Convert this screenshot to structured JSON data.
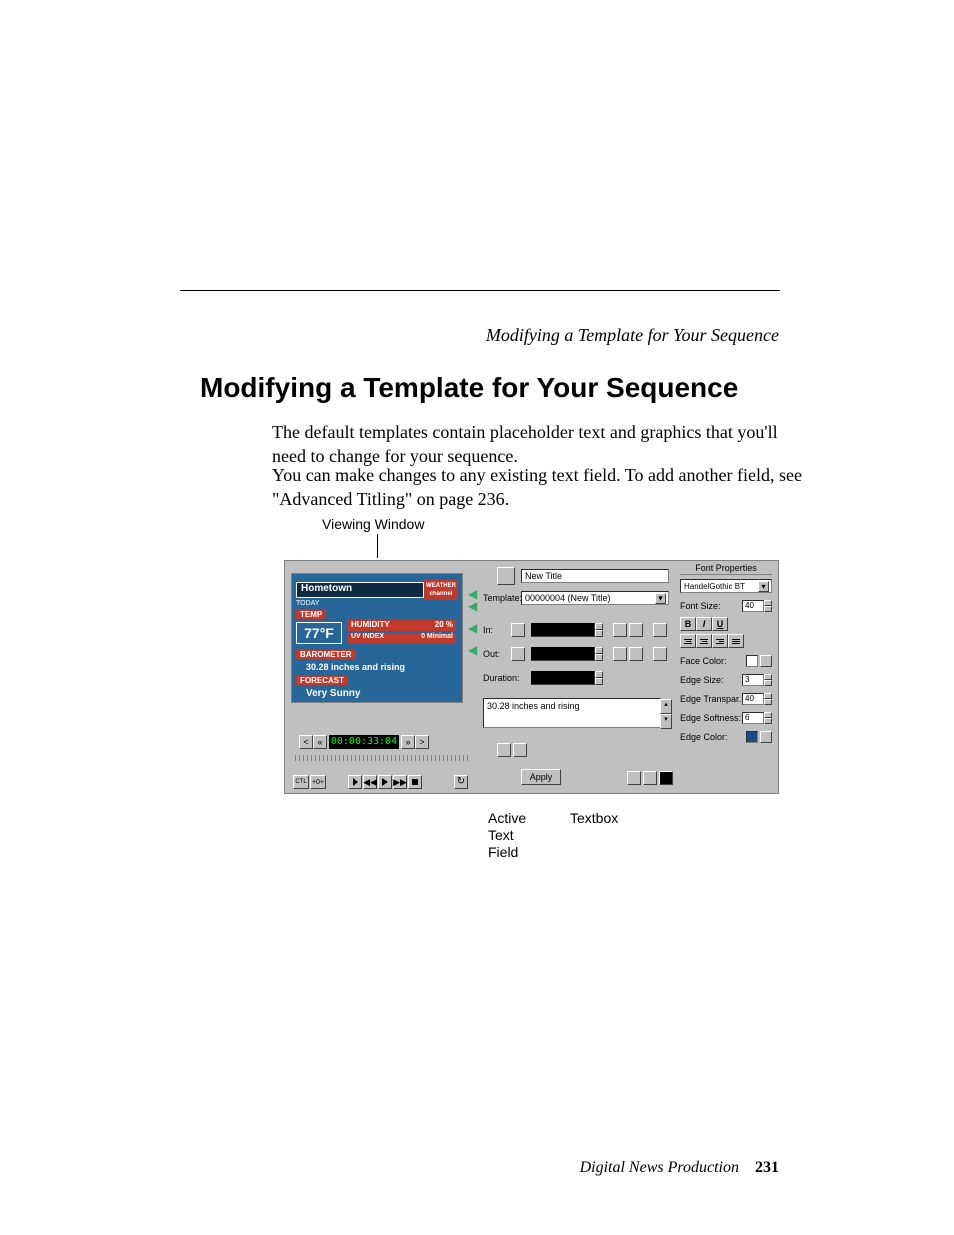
{
  "running_head": "Modifying a Template for Your Sequence",
  "h1": "Modifying a Template for Your Sequence",
  "p1": "The default templates contain placeholder text and graphics that you'll need to change for your sequence.",
  "p2": "You can make changes to any existing text field. To add another field, see \"Advanced Titling\" on page 236.",
  "labels": {
    "viewing": "Viewing Window",
    "active": "Active\nText\nField",
    "textbox": "Textbox"
  },
  "viewer": {
    "location": "Hometown",
    "logo": "WEATHER channel",
    "today": "TODAY",
    "temp_label": "TEMP",
    "temp": "77°F",
    "humidity_label": "HUMIDITY",
    "humidity": "20 %",
    "uv_label": "UV INDEX",
    "uv": "0 Minimal",
    "barometer_label": "BAROMETER",
    "barometer": "30.28 inches and rising",
    "forecast_label": "FORECAST",
    "forecast": "Very Sunny"
  },
  "timecode": "00:00:33:04",
  "middle": {
    "title_input": "New Title",
    "template_label": "Template:",
    "template_value": "00000004 (New Title)",
    "in_label": "In:",
    "out_label": "Out:",
    "duration_label": "Duration:",
    "textbox_value": "30.28 inches and rising",
    "apply": "Apply"
  },
  "font_props": {
    "heading": "Font Properties",
    "font": "HandelGothic BT",
    "size_label": "Font Size:",
    "size": "40",
    "face_label": "Face Color:",
    "face_color": "#ffffff",
    "edge_size_label": "Edge Size:",
    "edge_size": "3",
    "edge_trans_label": "Edge Transpar.",
    "edge_trans": "40",
    "edge_soft_label": "Edge Softness:",
    "edge_soft": "6",
    "edge_color_label": "Edge Color:",
    "edge_color": "#1a4a8a"
  },
  "footer": {
    "title": "Digital News Production",
    "page": "231"
  }
}
